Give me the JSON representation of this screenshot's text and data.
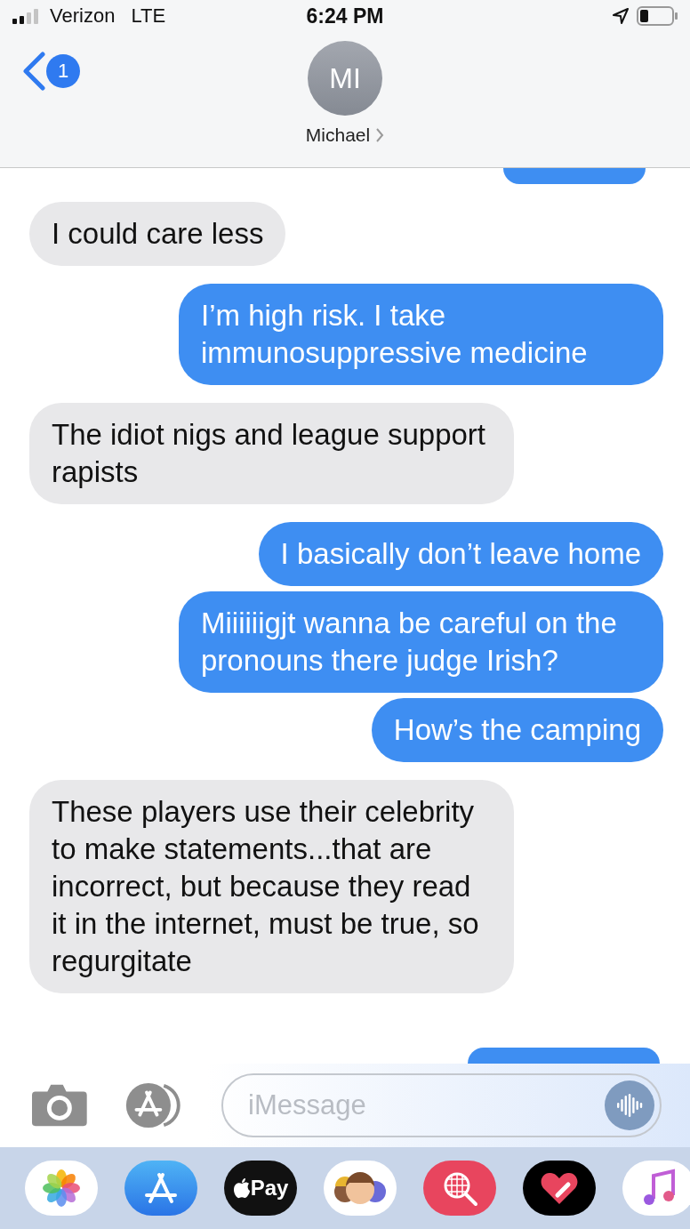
{
  "status_bar": {
    "carrier": "Verizon",
    "network": "LTE",
    "time": "6:24 PM"
  },
  "header": {
    "back_badge": "1",
    "avatar_initials": "MI",
    "contact_name": "Michael"
  },
  "messages": [
    {
      "kind": "received",
      "text": "I could care less"
    },
    {
      "kind": "sent",
      "text": "I’m high risk. I take immunosuppressive medicine"
    },
    {
      "kind": "received",
      "text": "The idiot nigs and league support rapists"
    },
    {
      "kind": "sent",
      "text": "I basically don’t leave home"
    },
    {
      "kind": "sent",
      "text": "Miiiiiigjt wanna be careful on the pronouns there judge Irish?"
    },
    {
      "kind": "sent",
      "text": "How’s the camping"
    },
    {
      "kind": "received",
      "text": "These players use their celebrity to make statements...that are incorrect, but because they read it in the internet, must be true, so regurgitate"
    }
  ],
  "compose": {
    "placeholder": "iMessage"
  },
  "dock": {
    "apple_pay_label": "Pay"
  }
}
